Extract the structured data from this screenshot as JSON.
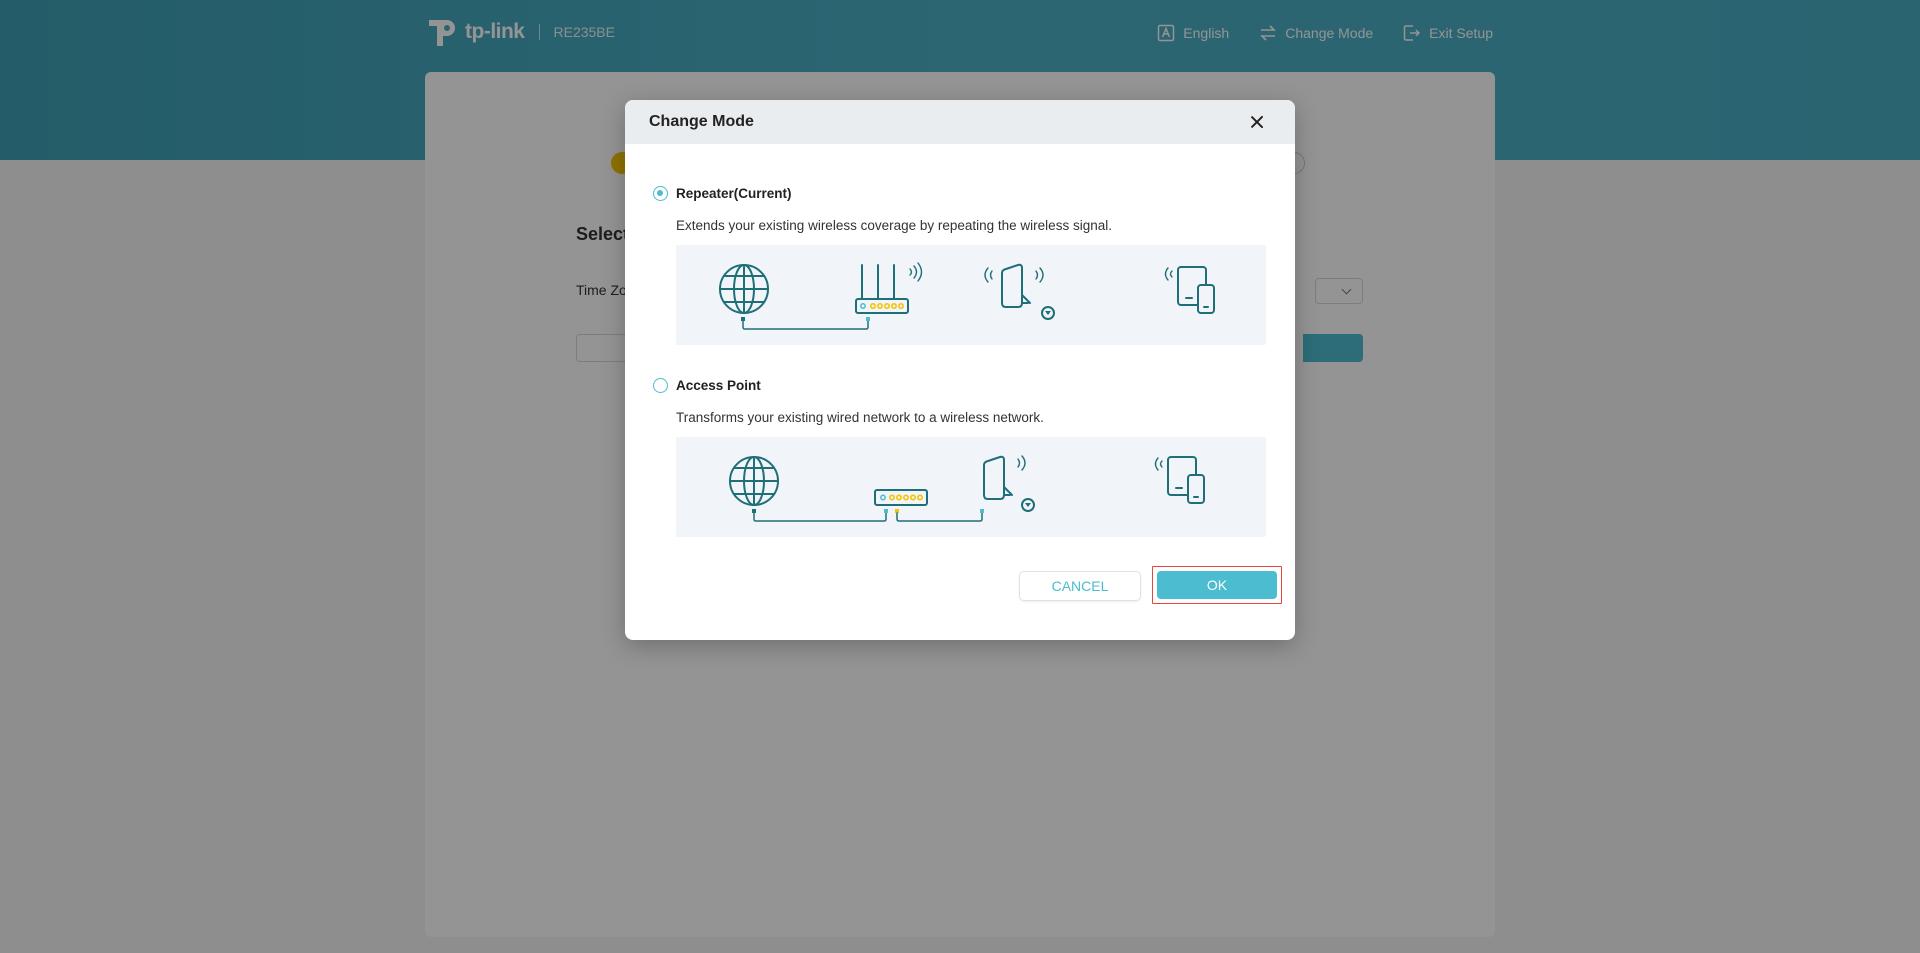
{
  "header": {
    "brand": "tp-link",
    "model": "RE235BE",
    "nav": {
      "language": "English",
      "change_mode": "Change Mode",
      "exit_setup": "Exit Setup"
    }
  },
  "background": {
    "title": "Select",
    "label": "Time Zo"
  },
  "modal": {
    "title": "Change Mode",
    "options": [
      {
        "label": "Repeater(Current)",
        "description": "Extends your existing wireless coverage by repeating the wireless signal.",
        "selected": true
      },
      {
        "label": "Access Point",
        "description": "Transforms your existing wired network to a wireless network.",
        "selected": false
      }
    ],
    "cancel_label": "CANCEL",
    "ok_label": "OK"
  },
  "colors": {
    "accent": "#4cbcd0",
    "banner": "#49adc3",
    "highlight": "#e8453c",
    "step": "#f5c400"
  }
}
